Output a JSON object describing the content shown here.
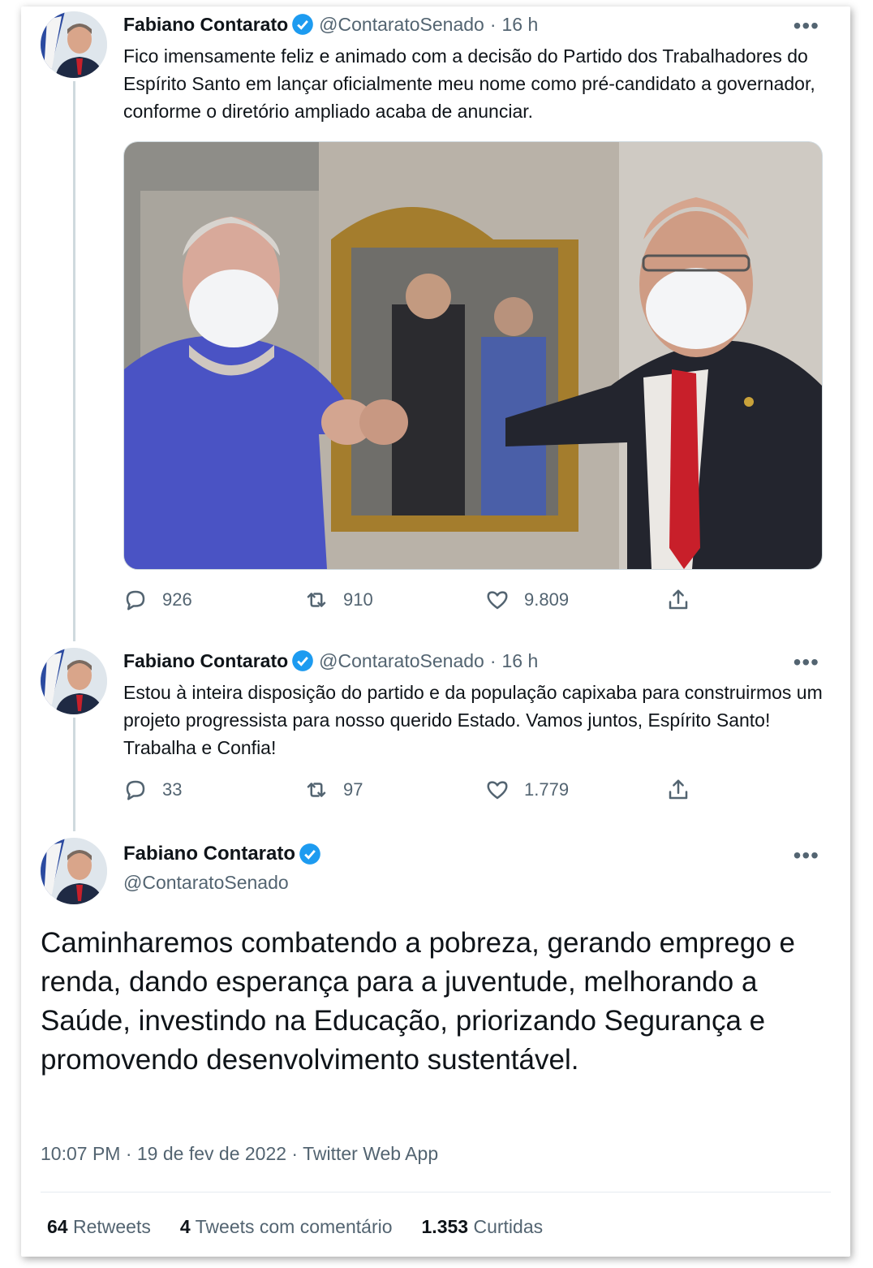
{
  "tweet1": {
    "name": "Fabiano Contarato",
    "handle": "@ContaratoSenado",
    "sep": "·",
    "time": "16 h",
    "more": "•••",
    "text": "Fico imensamente feliz e animado com a decisão do Partido dos Trabalhadores do Espírito Santo em lançar oficialmente meu nome como pré-candidato a governador, conforme o diretório ampliado acaba de anunciar.",
    "replies": "926",
    "retweets": "910",
    "likes": "9.809"
  },
  "tweet2": {
    "name": "Fabiano Contarato",
    "handle": "@ContaratoSenado",
    "sep": "·",
    "time": "16 h",
    "more": "•••",
    "text": "Estou à inteira disposição do partido e da população capixaba para construirmos um projeto progressista para nosso querido Estado. Vamos juntos, Espírito Santo! Trabalha e Confia!",
    "replies": "33",
    "retweets": "97",
    "likes": "1.779"
  },
  "main": {
    "name": "Fabiano Contarato",
    "handle": "@ContaratoSenado",
    "more": "•••",
    "text": "Caminharemos combatendo a pobreza, gerando emprego e renda, dando esperança para a juventude, melhorando a Saúde, investindo na Educação, priorizando Segurança e promovendo desenvolvimento sustentável.",
    "meta": "10:07 PM · 19 de fev de 2022 · Twitter Web App",
    "stats": {
      "retweets_count": "64",
      "retweets_label": "Retweets",
      "quotes_count": "4",
      "quotes_label": "Tweets com comentário",
      "likes_count": "1.353",
      "likes_label": "Curtidas"
    }
  },
  "colors": {
    "verified": "#1d9bf0",
    "text": "#0f1419",
    "secondary": "#536471"
  },
  "icons": [
    "reply-icon",
    "retweet-icon",
    "like-icon",
    "share-icon",
    "verified-badge-icon",
    "more-icon"
  ]
}
